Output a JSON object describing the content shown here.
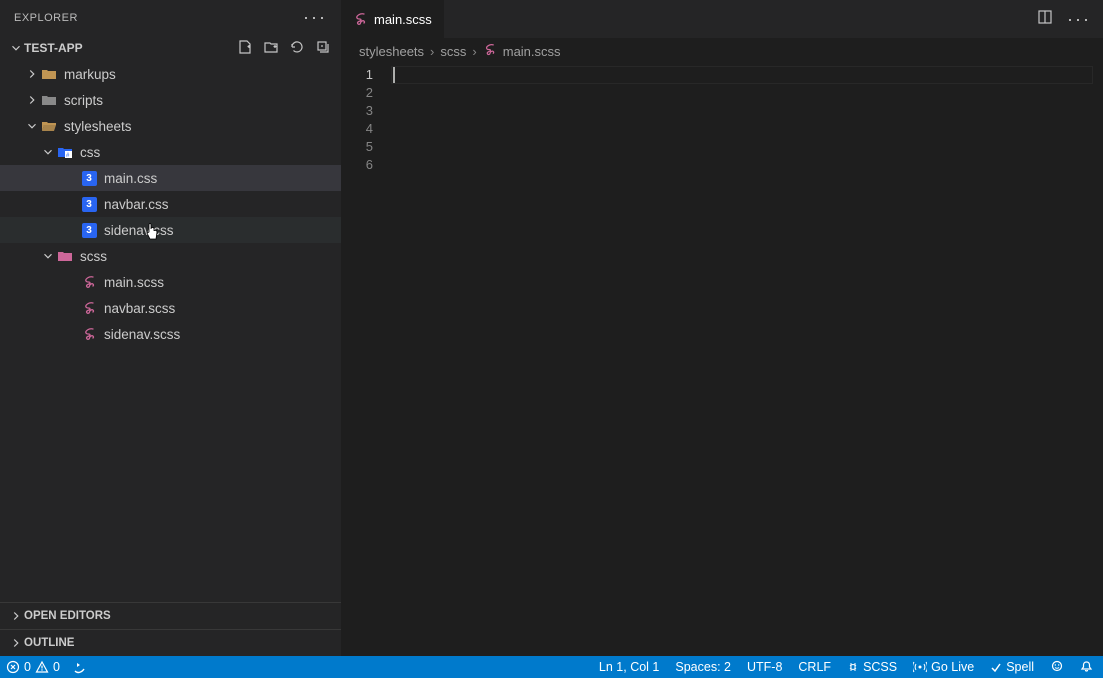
{
  "explorer": {
    "title": "EXPLORER",
    "project": "TEST-APP",
    "tree": {
      "markups": "markups",
      "scripts": "scripts",
      "stylesheets": "stylesheets",
      "css": "css",
      "main_css": "main.css",
      "navbar_css": "navbar.css",
      "sidenav_css": "sidenav.css",
      "scss": "scss",
      "main_scss": "main.scss",
      "navbar_scss": "navbar.scss",
      "sidenav_scss": "sidenav.scss"
    },
    "open_editors": "OPEN EDITORS",
    "outline": "OUTLINE"
  },
  "tab": {
    "filename": "main.scss"
  },
  "breadcrumb": {
    "part1": "stylesheets",
    "part2": "scss",
    "part3": "main.scss"
  },
  "editor": {
    "lines": [
      "1",
      "2",
      "3",
      "4",
      "5",
      "6"
    ]
  },
  "status": {
    "errors": "0",
    "warnings": "0",
    "position": "Ln 1, Col 1",
    "spaces": "Spaces: 2",
    "encoding": "UTF-8",
    "eol": "CRLF",
    "lang": "SCSS",
    "golive": "Go Live",
    "spell": "Spell"
  },
  "icons": {
    "css_badge": "ⵘ"
  }
}
